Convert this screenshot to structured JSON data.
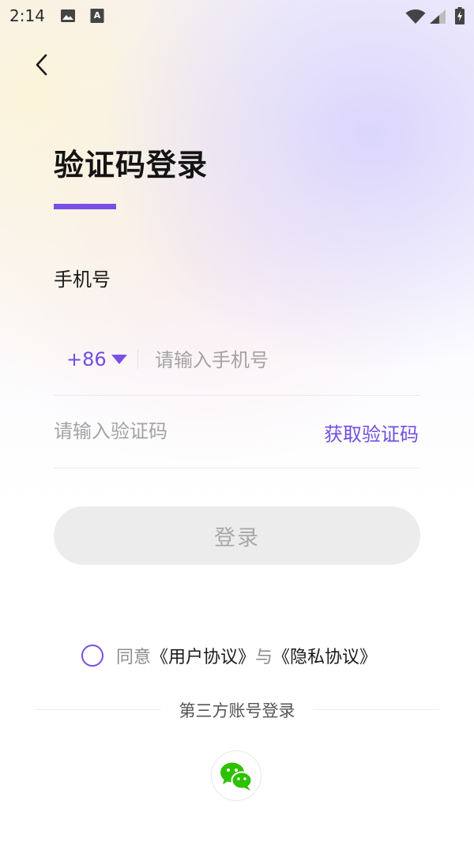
{
  "status_bar": {
    "time": "2:14",
    "icons": [
      "image-icon",
      "a-notification-icon",
      "wifi-icon",
      "signal-icon",
      "battery-charging-icon"
    ]
  },
  "header": {
    "back_icon": "chevron-left-icon",
    "title": "验证码登录"
  },
  "form": {
    "phone_label": "手机号",
    "country_code": "+86",
    "phone_placeholder": "请输入手机号",
    "phone_value": "",
    "code_placeholder": "请输入验证码",
    "code_value": "",
    "get_code_label": "获取验证码",
    "login_label": "登录"
  },
  "agreement": {
    "agree_text": "同意",
    "user_agreement": "《用户协议》",
    "and_text": "与",
    "privacy_agreement": "《隐私协议》",
    "checked": false
  },
  "third_party": {
    "title": "第三方账号登录",
    "providers": [
      "wechat-icon"
    ]
  },
  "colors": {
    "accent": "#7a4fe6",
    "link": "#6f4fe0",
    "button_disabled_bg": "#ececec",
    "button_disabled_text": "#a8a8a8",
    "wechat_green": "#2dc100"
  }
}
